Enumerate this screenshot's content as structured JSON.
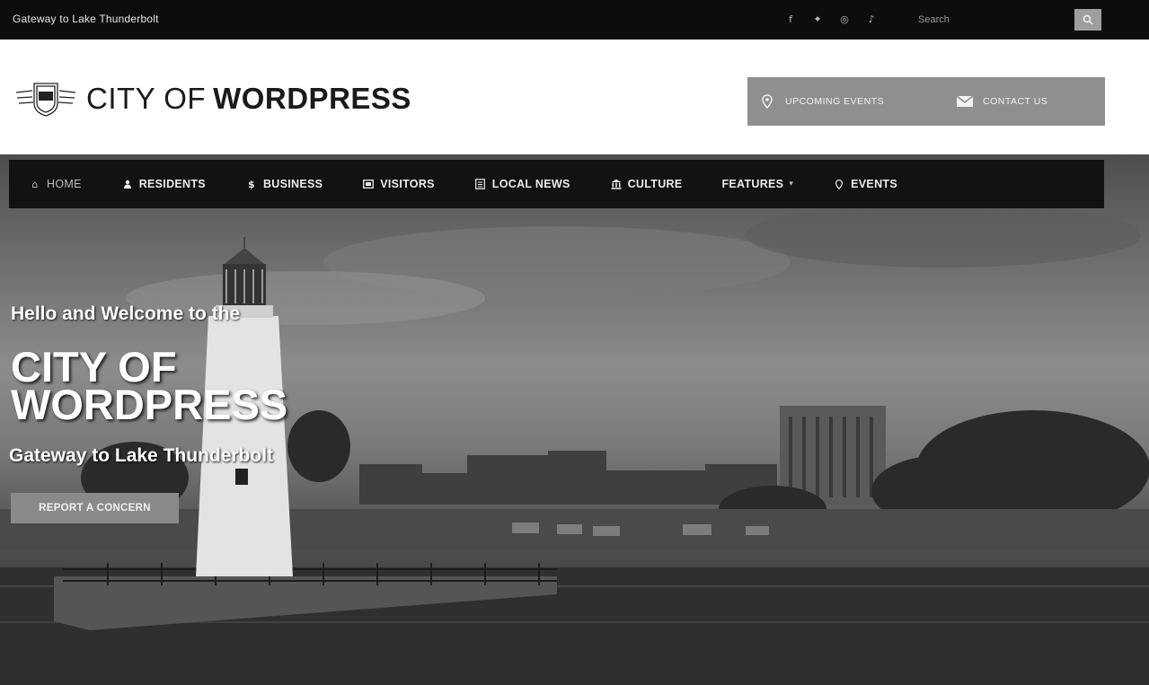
{
  "topbar": {
    "tagline": "Gateway to Lake Thunderbolt",
    "social_icons": [
      "facebook-icon",
      "twitter-icon",
      "instagram-icon",
      "foursquare-icon"
    ],
    "search_placeholder": "Search"
  },
  "header": {
    "logo_light": "CITY OF",
    "logo_bold": "WORDPRESS",
    "upcoming_events_label": "UPCOMING EVENTS",
    "contact_us_label": "CONTACT US"
  },
  "nav": {
    "items": [
      {
        "label": "HOME",
        "icon": "home-icon",
        "active": true
      },
      {
        "label": "RESIDENTS",
        "icon": "user-icon"
      },
      {
        "label": "BUSINESS",
        "icon": "dollar-icon"
      },
      {
        "label": "VISITORS",
        "icon": "ticket-icon"
      },
      {
        "label": "LOCAL NEWS",
        "icon": "newspaper-icon"
      },
      {
        "label": "CULTURE",
        "icon": "institution-icon"
      },
      {
        "label": "FEATURES",
        "icon": "caret-down-icon",
        "has_dropdown": true
      },
      {
        "label": "EVENTS",
        "icon": "map-marker-icon"
      }
    ]
  },
  "hero": {
    "intro": "Hello and Welcome to the",
    "title": "CITY OF WORDPRESS",
    "subtitle": "Gateway to Lake Thunderbolt",
    "cta_label": "REPORT A CONCERN"
  },
  "colors": {
    "topbar_bg": "#0d0d0d",
    "nav_bg": "#121212",
    "accent_gray": "#8f8f8f"
  }
}
